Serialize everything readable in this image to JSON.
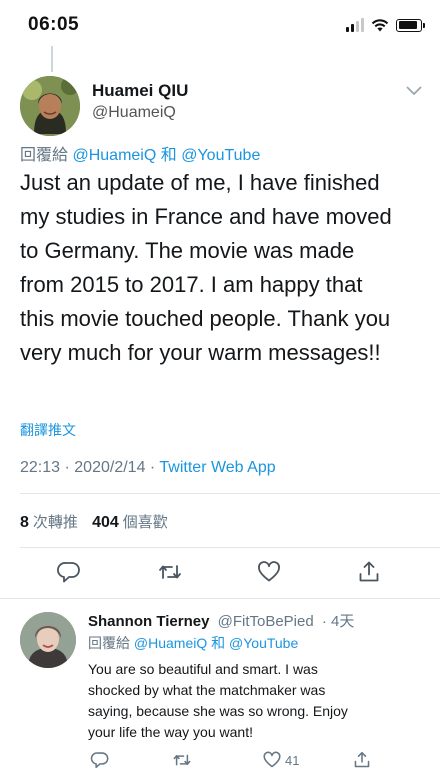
{
  "status_bar": {
    "time": "06:05"
  },
  "tweet": {
    "display_name": "Huamei QIU",
    "handle": "@HuameiQ",
    "replying_prefix": "回覆給",
    "replying_user1": "@HuameiQ",
    "replying_and": "和",
    "replying_user2": "@YouTube",
    "text_lines": [
      "Just an update of me, I have finished",
      "my studies in France and have moved",
      "to Germany. The movie was made",
      "from 2015 to 2017. I am happy that",
      "this movie touched people. Thank you",
      "very much for your warm messages!!"
    ],
    "translate_label": "翻譯推文",
    "time": "22:13",
    "date": "2020/2/14",
    "app": "Twitter Web App",
    "retweet_count": "8",
    "retweet_label": "次轉推",
    "like_count": "404",
    "like_label": "個喜歡"
  },
  "reply": {
    "display_name": "Shannon Tierney",
    "handle": "@FitToBePied",
    "age": "4天",
    "replying_prefix": "回覆給",
    "replying_user1": "@HuameiQ",
    "replying_and": "和",
    "replying_user2": "@YouTube",
    "text_lines": [
      "You are so beautiful and smart. I was",
      "shocked by what the matchmaker was",
      "saying, because she was so wrong. Enjoy",
      "your life the way you want!"
    ],
    "like_count": "41"
  },
  "icons": {
    "reply": "reply-icon",
    "retweet": "retweet-icon",
    "like": "heart-icon",
    "share": "share-icon",
    "more": "chevron-down-icon"
  },
  "colors": {
    "accent": "#1b95e0",
    "muted": "#657786",
    "text": "#14171a"
  }
}
